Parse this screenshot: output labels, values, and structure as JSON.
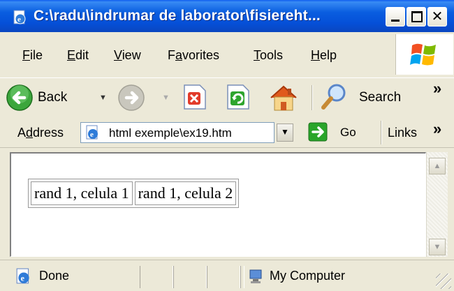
{
  "window": {
    "title": "C:\\radu\\indrumar de laborator\\fisiereht..."
  },
  "menu": {
    "items": [
      {
        "label": "File",
        "underline_index": 0
      },
      {
        "label": "Edit",
        "underline_index": 0
      },
      {
        "label": "View",
        "underline_index": 0
      },
      {
        "label": "Favorites",
        "underline_index": 1
      },
      {
        "label": "Tools",
        "underline_index": 0
      },
      {
        "label": "Help",
        "underline_index": 0
      }
    ]
  },
  "toolbar": {
    "back_label": "Back",
    "search_label": "Search",
    "overflow": "»"
  },
  "address": {
    "label": "Address",
    "value": "html exemple\\ex19.htm",
    "go_label": "Go",
    "links_label": "Links",
    "overflow": "»"
  },
  "page_table": {
    "rows": [
      [
        "rand 1, celula 1",
        "rand 1, celula 2"
      ]
    ]
  },
  "status": {
    "left_text": "Done",
    "zone_text": "My Computer"
  },
  "colors": {
    "titlebar": "#0a5ee0",
    "chrome": "#ece9d8",
    "go_green": "#2aa52a"
  }
}
